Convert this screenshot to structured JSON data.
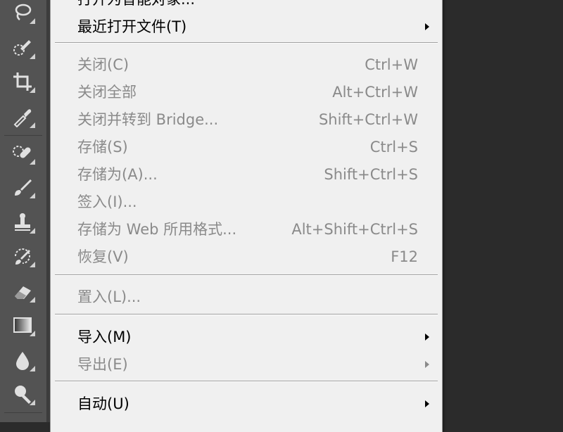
{
  "toolbar": {
    "tools": [
      {
        "icon": "lasso-icon"
      },
      {
        "icon": "quick-selection-icon"
      },
      {
        "icon": "crop-icon"
      },
      {
        "icon": "eyedropper-icon"
      },
      {
        "icon": "healing-brush-icon"
      },
      {
        "icon": "brush-icon"
      },
      {
        "icon": "clone-stamp-icon"
      },
      {
        "icon": "history-brush-icon"
      },
      {
        "icon": "eraser-icon"
      },
      {
        "icon": "gradient-icon"
      },
      {
        "icon": "blur-icon"
      },
      {
        "icon": "dodge-icon"
      }
    ]
  },
  "menu": {
    "partial_top_label": "打开为智能对象...",
    "recent_label": "最近打开文件(T)",
    "close_label": "关闭(C)",
    "close_shortcut": "Ctrl+W",
    "close_all_label": "关闭全部",
    "close_all_shortcut": "Alt+Ctrl+W",
    "close_bridge_label": "关闭并转到 Bridge...",
    "close_bridge_shortcut": "Shift+Ctrl+W",
    "save_label": "存储(S)",
    "save_shortcut": "Ctrl+S",
    "save_as_label": "存储为(A)...",
    "save_as_shortcut": "Shift+Ctrl+S",
    "checkin_label": "签入(I)...",
    "save_web_label": "存储为 Web 所用格式...",
    "save_web_shortcut": "Alt+Shift+Ctrl+S",
    "revert_label": "恢复(V)",
    "revert_shortcut": "F12",
    "place_label": "置入(L)...",
    "import_label": "导入(M)",
    "export_label": "导出(E)",
    "automate_label": "自动(U)"
  },
  "colors": {
    "menu_bg": "#f0f0f0",
    "enabled_text": "#000000",
    "disabled_text": "#8a8a8a",
    "toolbar_bg": "#535353",
    "canvas_bg": "#2b2b2b"
  }
}
